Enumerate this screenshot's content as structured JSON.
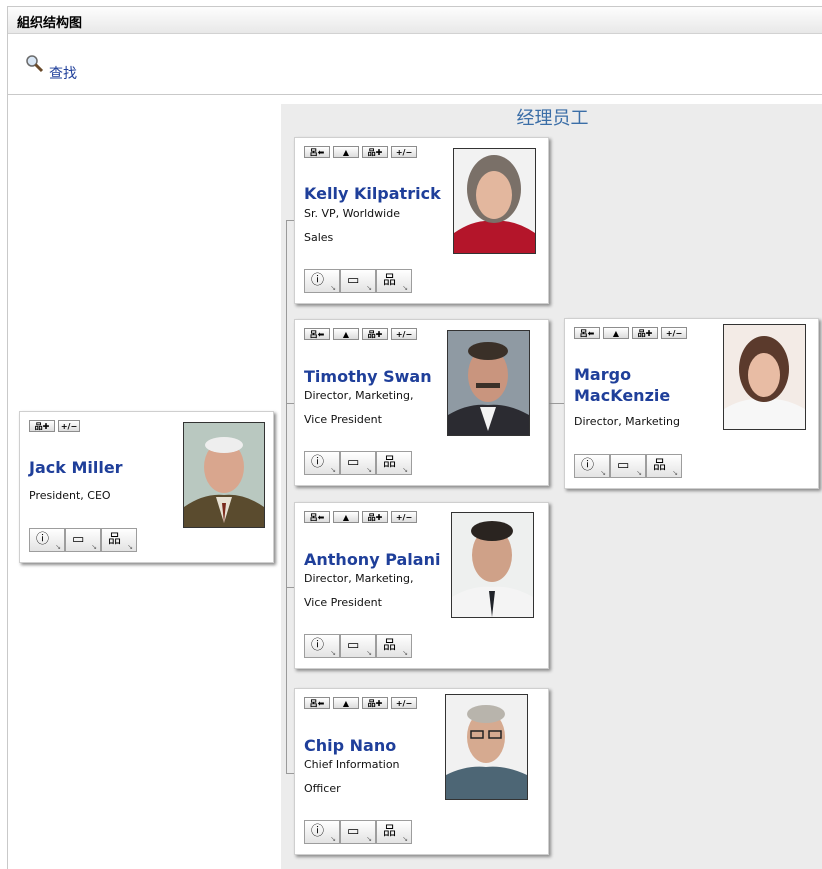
{
  "window": {
    "title": "組织结构图"
  },
  "toolbar": {
    "find_label": "查找",
    "find_icon": "magnifier-icon"
  },
  "section": {
    "heading": "经理员工"
  },
  "buttons": {
    "up_to_manager": "呂⬅",
    "up": "▲",
    "expand_reports": "品✚",
    "toggle": "+/−",
    "info": "ⓘ",
    "contact": "▭",
    "orgchart": "品"
  },
  "root": {
    "name": "Jack Miller",
    "line1": "President, CEO",
    "line2": ""
  },
  "reports": [
    {
      "name": "Kelly Kilpatrick",
      "line1": "Sr. VP, Worldwide",
      "line2": "Sales"
    },
    {
      "name": "Timothy Swan",
      "line1": "Director, Marketing,",
      "line2": "Vice President"
    },
    {
      "name": "Anthony Palani",
      "line1": "Director, Marketing,",
      "line2": "Vice President"
    },
    {
      "name": "Chip Nano",
      "line1": "Chief Information",
      "line2": "Officer"
    }
  ],
  "peer": {
    "name_line1": "Margo",
    "name_line2": "MacKenzie",
    "line1": "Director, Marketing"
  },
  "colors": {
    "link": "#1f3f9a",
    "heading": "#3b6ea7",
    "panel": "#ececec"
  }
}
